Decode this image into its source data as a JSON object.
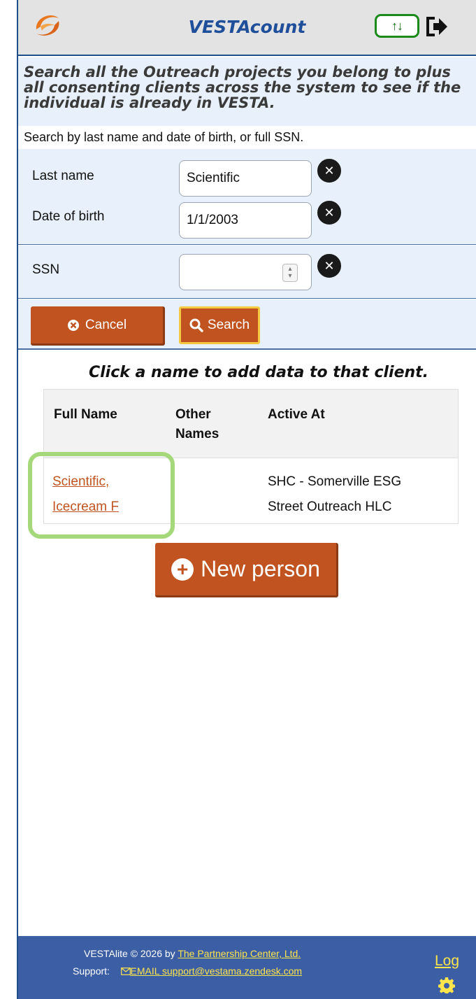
{
  "header": {
    "app_title": "VESTAcount",
    "sync_icon_text": "↑↓"
  },
  "info": {
    "bold_text": "Search all the Outreach projects you belong to plus all consenting clients across the system to see if the individual is already in VESTA.",
    "sub_text": "Search by last name and date of birth, or full SSN."
  },
  "form": {
    "last_name_label": "Last name",
    "last_name_value": "Scientific",
    "dob_label": "Date of birth",
    "dob_value": "1/1/2003",
    "ssn_label": "SSN",
    "ssn_value": ""
  },
  "actions": {
    "cancel_label": "Cancel",
    "search_label": "Search"
  },
  "results": {
    "instruction": "Click a name to add data to that client.",
    "columns": [
      "Full Name",
      "Other Names",
      "Active At"
    ],
    "rows": [
      {
        "full_name_line1": "Scientific,",
        "full_name_line2": "Icecream F",
        "other_names": "",
        "active_at_line1": "SHC - Somerville ESG",
        "active_at_line2": "Street Outreach HLC"
      }
    ]
  },
  "new_person_label": "New person",
  "footer": {
    "copyright_prefix": "VESTAlite © 2026 by",
    "company_link": "The Partnership Center, Ltd.",
    "support_label": "Support:",
    "email_link": "EMAIL support@vestama.zendesk.com",
    "log_label": "Log"
  },
  "colors": {
    "accent": "#c0531f",
    "header_title": "#1f4f9a",
    "footer_bg": "#3c5ea4",
    "highlight": "#a5d87a"
  }
}
